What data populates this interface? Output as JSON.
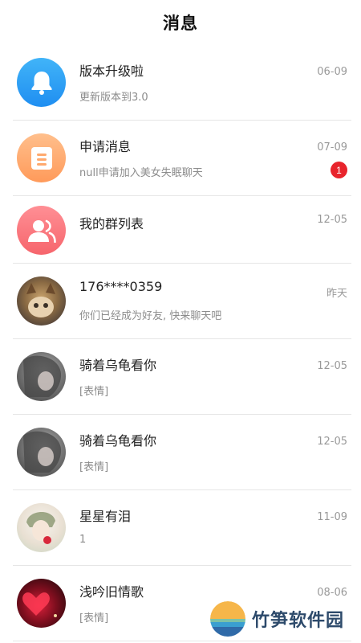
{
  "header": {
    "title": "消息"
  },
  "conversations": [
    {
      "avatar_icon": "bell-icon",
      "name": "版本升级啦",
      "time": "06-09",
      "preview": "更新版本到3.0",
      "badge": ""
    },
    {
      "avatar_icon": "document-icon",
      "name": "申请消息",
      "time": "07-09",
      "preview": "null申请加入美女失眠聊天",
      "badge": "1"
    },
    {
      "avatar_icon": "group-icon",
      "name": "我的群列表",
      "time": "12-05",
      "preview": "",
      "badge": ""
    },
    {
      "avatar_icon": "cat-photo",
      "name": "176****0359",
      "time": "昨天",
      "preview": "你们已经成为好友, 快来聊天吧",
      "badge": ""
    },
    {
      "avatar_icon": "girl-photo",
      "name": "骑着乌龟看你",
      "time": "12-05",
      "preview": "[表情]",
      "badge": ""
    },
    {
      "avatar_icon": "girl-photo",
      "name": "骑着乌龟看你",
      "time": "12-05",
      "preview": "[表情]",
      "badge": ""
    },
    {
      "avatar_icon": "anime-boy-photo",
      "name": "星星有泪",
      "time": "11-09",
      "preview": "1",
      "badge": ""
    },
    {
      "avatar_icon": "red-heart-photo",
      "name": "浅吟旧情歌",
      "time": "08-06",
      "preview": "[表情]",
      "badge": ""
    }
  ],
  "watermark": {
    "text": "竹笋软件园"
  },
  "colors": {
    "badge": "#e8242c",
    "bell": "#2a9cf5",
    "apply": "#ffa96e",
    "group": "#f77379"
  }
}
